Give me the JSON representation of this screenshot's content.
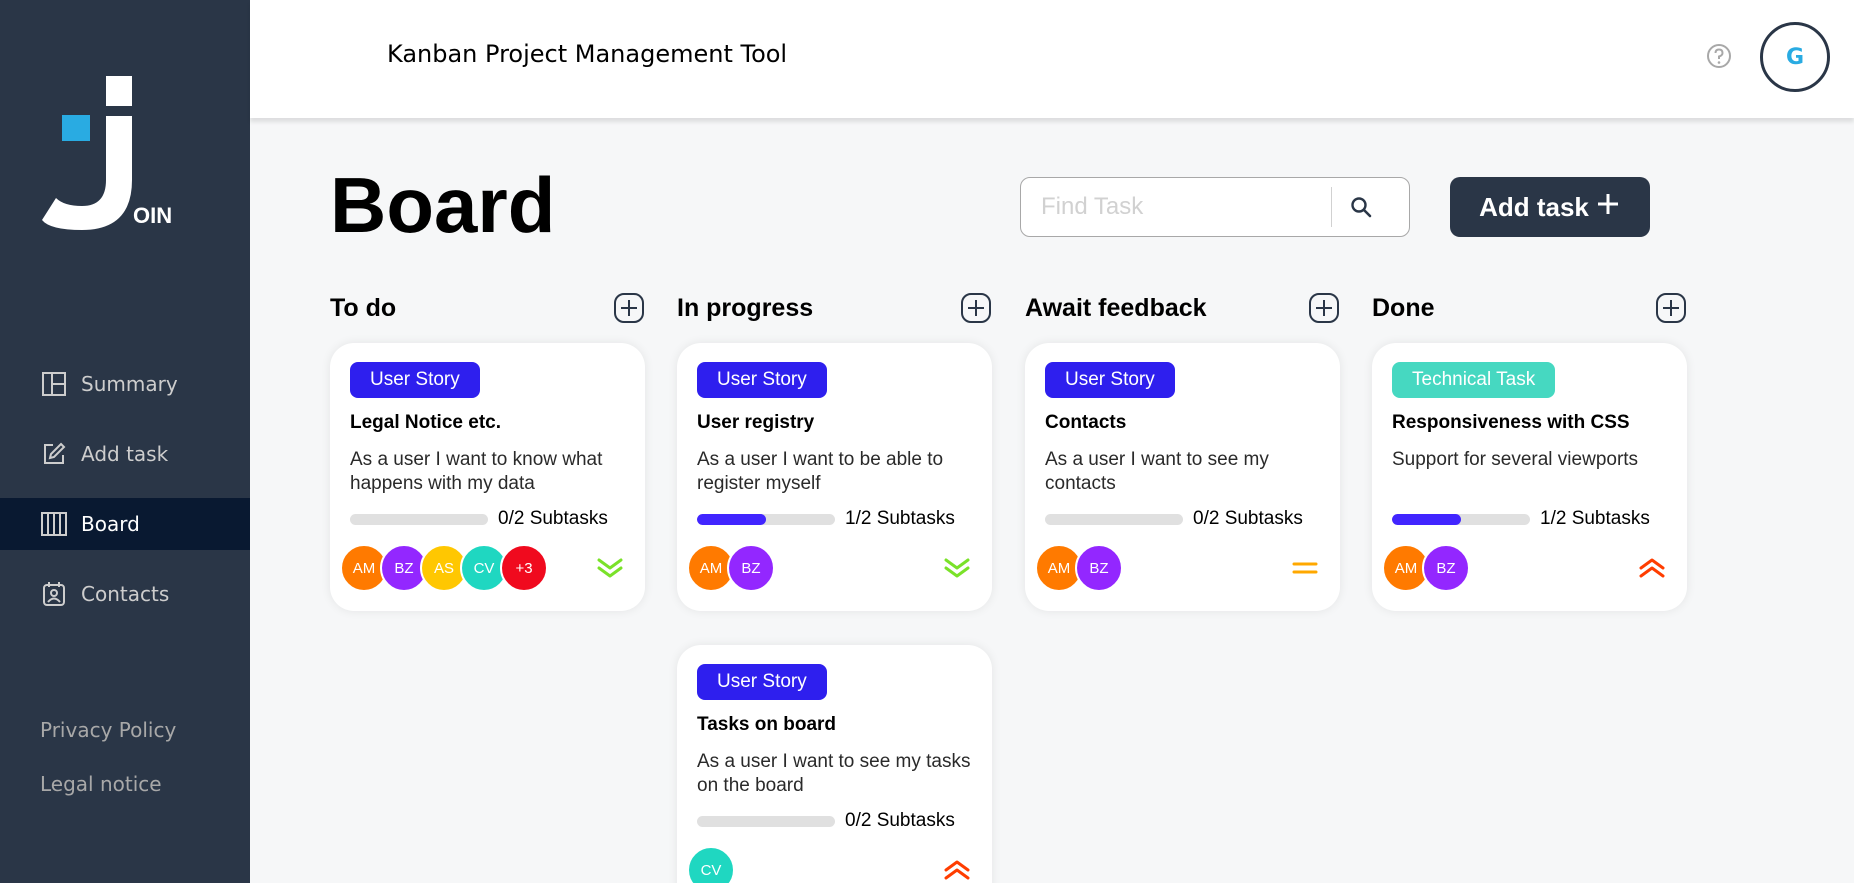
{
  "header": {
    "title": "Kanban Project Management Tool",
    "help_icon": "help-circle-icon",
    "user_initial": "G"
  },
  "sidebar": {
    "logo_text": "OIN",
    "items": [
      {
        "label": "Summary",
        "icon": "summary-icon"
      },
      {
        "label": "Add task",
        "icon": "edit-icon"
      },
      {
        "label": "Board",
        "icon": "board-icon"
      },
      {
        "label": "Contacts",
        "icon": "contacts-icon"
      }
    ],
    "active": "Board",
    "legal": [
      "Privacy Policy",
      "Legal notice"
    ]
  },
  "board": {
    "title": "Board",
    "search": {
      "placeholder": "Find Task",
      "value": ""
    },
    "add_button": "Add task"
  },
  "colors": {
    "sidebar_bg": "#2a3647",
    "active_nav_bg": "#091931",
    "user_story": "#2e1fee",
    "technical_task": "#46d8c1",
    "progress": "#4125ff",
    "prio_low": "#7ae229",
    "prio_medium": "#ffa800",
    "prio_urgent": "#ff3d00"
  },
  "columns": [
    {
      "title": "To do",
      "cards": [
        {
          "tag": "User Story",
          "tag_color": "#2e1fee",
          "title": "Legal Notice etc.",
          "desc": "As a user I want to know what happens with my data",
          "progress": "0/2 Subtasks",
          "progress_fraction": 0.0,
          "avatars": [
            {
              "initials": "AM",
              "color": "#ff7a00"
            },
            {
              "initials": "BZ",
              "color": "#9327ff"
            },
            {
              "initials": "AS",
              "color": "#ffc701"
            },
            {
              "initials": "CV",
              "color": "#1fd7c1"
            },
            {
              "initials": "+3",
              "color": "#f00a1e"
            }
          ],
          "priority": "low"
        }
      ]
    },
    {
      "title": "In progress",
      "cards": [
        {
          "tag": "User Story",
          "tag_color": "#2e1fee",
          "title": "User registry",
          "desc": "As a user I want to be able to register myself",
          "progress": "1/2 Subtasks",
          "progress_fraction": 0.5,
          "avatars": [
            {
              "initials": "AM",
              "color": "#ff7a00"
            },
            {
              "initials": "BZ",
              "color": "#9327ff"
            }
          ],
          "priority": "low"
        },
        {
          "tag": "User Story",
          "tag_color": "#2e1fee",
          "title": "Tasks on board",
          "desc": "As a user I want to see my tasks on the board",
          "progress": "0/2 Subtasks",
          "progress_fraction": 0.0,
          "avatars": [
            {
              "initials": "CV",
              "color": "#1fd7c1"
            }
          ],
          "priority": "urgent"
        }
      ]
    },
    {
      "title": "Await feedback",
      "cards": [
        {
          "tag": "User Story",
          "tag_color": "#2e1fee",
          "title": "Contacts",
          "desc": "As a user I want to see my contacts",
          "progress": "0/2 Subtasks",
          "progress_fraction": 0.0,
          "avatars": [
            {
              "initials": "AM",
              "color": "#ff7a00"
            },
            {
              "initials": "BZ",
              "color": "#9327ff"
            }
          ],
          "priority": "medium"
        }
      ]
    },
    {
      "title": "Done",
      "cards": [
        {
          "tag": "Technical Task",
          "tag_color": "#46d8c1",
          "title": "Responsiveness with CSS",
          "desc": "Support for several viewports",
          "progress": "1/2 Subtasks",
          "progress_fraction": 0.5,
          "avatars": [
            {
              "initials": "AM",
              "color": "#ff7a00"
            },
            {
              "initials": "BZ",
              "color": "#9327ff"
            }
          ],
          "priority": "urgent"
        }
      ]
    }
  ]
}
